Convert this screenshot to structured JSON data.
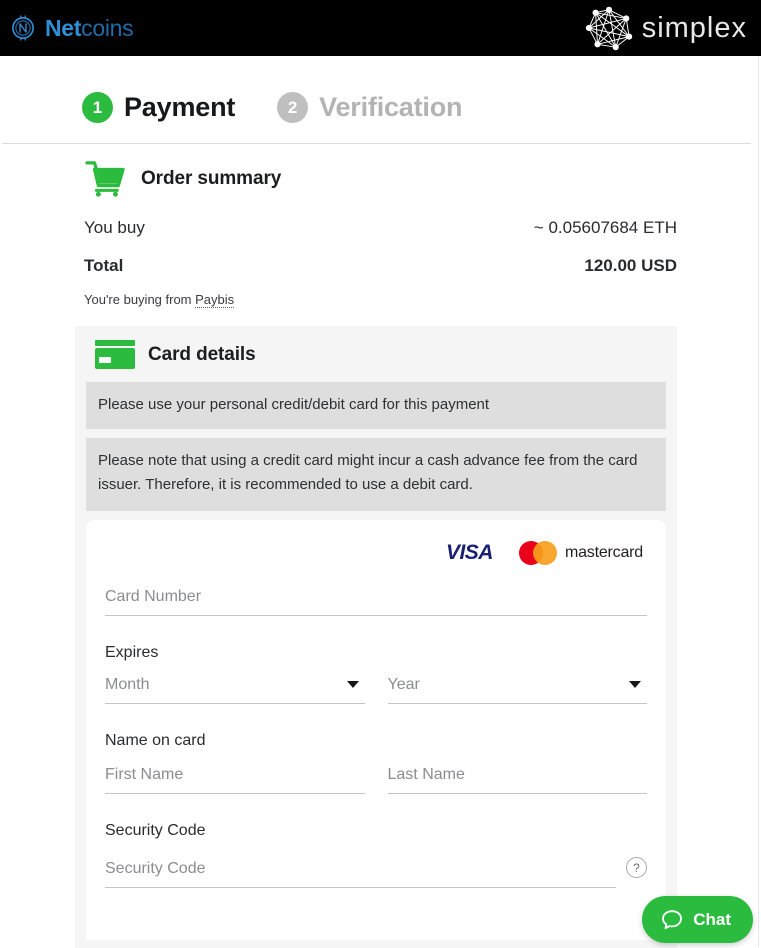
{
  "header": {
    "brand_left": {
      "name_bold": "Net",
      "name_light": "coins",
      "icon": "netcoins-logo-icon"
    },
    "brand_right": {
      "name": "simplex",
      "icon": "simplex-network-icon"
    },
    "background_color": "#000000"
  },
  "steps": [
    {
      "number": "1",
      "label": "Payment",
      "state": "active",
      "color": "#2bbc3f"
    },
    {
      "number": "2",
      "label": "Verification",
      "state": "inactive",
      "color": "#bfbfbf"
    }
  ],
  "order_summary": {
    "title": "Order summary",
    "icon": "shopping-cart-icon",
    "you_buy_label": "You buy",
    "you_buy_value": "~ 0.05607684 ETH",
    "total_label": "Total",
    "total_value": "120.00 USD",
    "buying_from_prefix": "You're buying from ",
    "merchant": "Paybis"
  },
  "card_details": {
    "title": "Card details",
    "icon": "credit-card-icon",
    "notice_primary": "Please use your personal credit/debit card for this payment",
    "notice_secondary": "Please note that using a credit card might incur a cash advance fee from the card issuer. Therefore, it is recommended to use a debit card.",
    "accepted_cards": [
      {
        "name": "VISA",
        "icon": "visa-logo-icon"
      },
      {
        "name": "mastercard",
        "icon": "mastercard-logo-icon"
      }
    ],
    "form": {
      "card_number": {
        "placeholder": "Card Number",
        "value": ""
      },
      "expires_label": "Expires",
      "month": {
        "selected": "Month"
      },
      "year": {
        "selected": "Year"
      },
      "name_on_card_label": "Name on card",
      "first_name": {
        "placeholder": "First Name",
        "value": ""
      },
      "last_name": {
        "placeholder": "Last Name",
        "value": ""
      },
      "security_code_label": "Security Code",
      "security_code": {
        "placeholder": "Security Code",
        "value": ""
      },
      "help_icon_glyph": "?"
    }
  },
  "chat_widget": {
    "label": "Chat",
    "icon": "chat-bubble-icon",
    "color": "#2bbc3f"
  }
}
